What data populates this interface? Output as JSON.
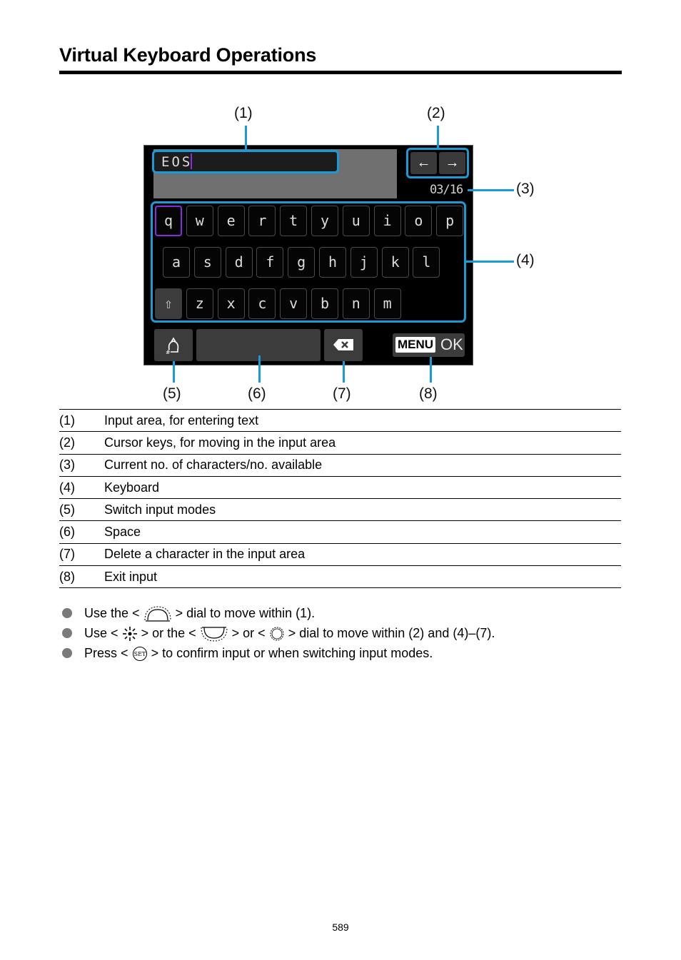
{
  "page": {
    "title": "Virtual Keyboard Operations",
    "page_number": "589"
  },
  "figure": {
    "callouts": [
      "(1)",
      "(2)",
      "(3)",
      "(4)",
      "(5)",
      "(6)",
      "(7)",
      "(8)"
    ],
    "input_text": "EOS",
    "counter": "03/16",
    "cursor_keys": {
      "left": "🡄",
      "right": "🡆"
    },
    "keyboard_rows": [
      [
        "q",
        "w",
        "e",
        "r",
        "t",
        "y",
        "u",
        "i",
        "o",
        "p"
      ],
      [
        "a",
        "s",
        "d",
        "f",
        "g",
        "h",
        "j",
        "k",
        "l"
      ],
      [
        "⇧",
        "z",
        "x",
        "c",
        "v",
        "b",
        "n",
        "m"
      ]
    ],
    "selected_key": "q",
    "buttons": {
      "mode_icon": "switch-mode-icon",
      "space": "",
      "delete": "⌫",
      "menu_tag": "MENU",
      "ok": "OK"
    },
    "colors": {
      "highlight": "#1a9ad6",
      "selection": "#8a2be2",
      "screen_bg": "#000000"
    }
  },
  "legend": [
    {
      "num": "(1)",
      "text": "Input area, for entering text"
    },
    {
      "num": "(2)",
      "text": "Cursor keys, for moving in the input area"
    },
    {
      "num": "(3)",
      "text": "Current no. of characters/no. available"
    },
    {
      "num": "(4)",
      "text": "Keyboard"
    },
    {
      "num": "(5)",
      "text": "Switch input modes"
    },
    {
      "num": "(6)",
      "text": "Space"
    },
    {
      "num": "(7)",
      "text": "Delete a character in the input area"
    },
    {
      "num": "(8)",
      "text": "Exit input"
    }
  ],
  "bullets": [
    {
      "parts": [
        "Use the <",
        "main-dial-icon",
        "> dial to move within (1)."
      ]
    },
    {
      "parts": [
        "Use <",
        "multi-controller-icon",
        "> or the <",
        "quick-control-dial-1-icon",
        "> or <",
        "quick-control-dial-2-icon",
        "> dial to move within (2) and (4)–(7)."
      ]
    },
    {
      "parts": [
        "Press <",
        "set-button-icon",
        "> to confirm input or when switching input modes."
      ]
    }
  ],
  "bullet_text": {
    "b0_a": "Use the <",
    "b0_b": "> dial to move within (1).",
    "b1_a": "Use <",
    "b1_b": "> or the <",
    "b1_c": "> or <",
    "b1_d": "> dial to move within (2) and (4)–(7).",
    "b2_a": "Press <",
    "b2_b": "> to confirm input or when switching input modes."
  }
}
